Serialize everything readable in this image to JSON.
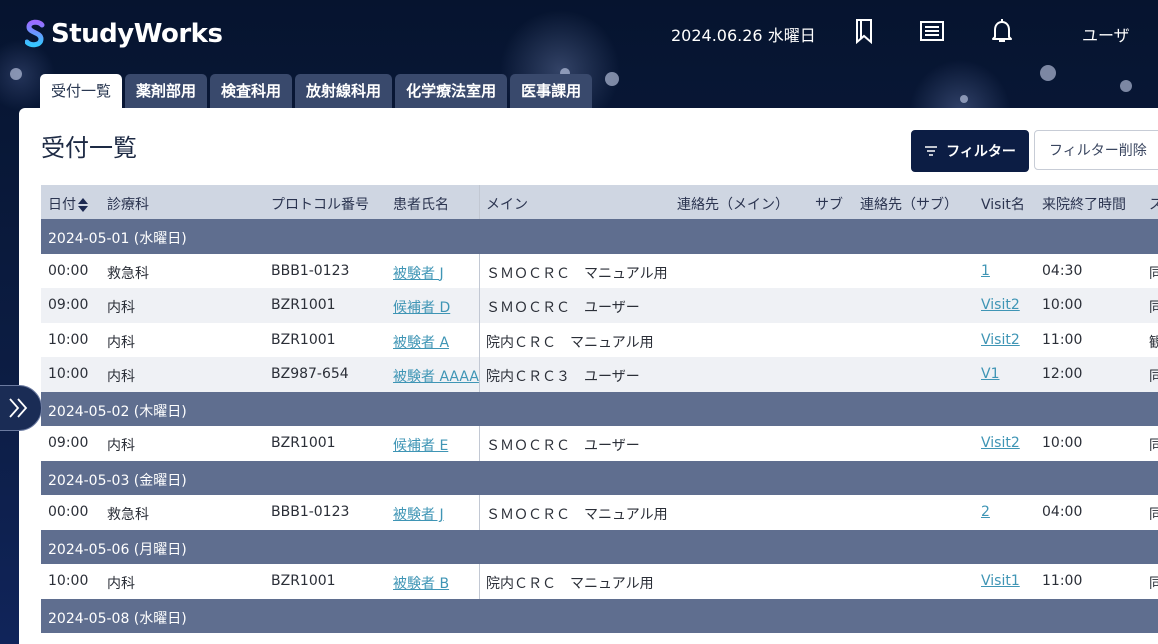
{
  "header": {
    "logo_letter": "S",
    "logo_text": "StudyWorks",
    "date": "2024.06.26 水曜日",
    "user": "ユーザ",
    "icons": [
      "bookmark-icon",
      "message-icon",
      "bell-icon"
    ]
  },
  "tabs": [
    {
      "label": "受付一覧",
      "active": true
    },
    {
      "label": "薬剤部用",
      "active": false
    },
    {
      "label": "検査科用",
      "active": false
    },
    {
      "label": "放射線科用",
      "active": false
    },
    {
      "label": "化学療法室用",
      "active": false
    },
    {
      "label": "医事課用",
      "active": false
    }
  ],
  "page_title": "受付一覧",
  "buttons": {
    "filter": "フィルター",
    "filter_clear": "フィルター削除"
  },
  "columns": [
    "日付",
    "診療科",
    "プロトコル番号",
    "患者氏名",
    "メイン",
    "連絡先（メイン）",
    "サブ",
    "連絡先（サブ）",
    "Visit名",
    "来院終了時間",
    "ス"
  ],
  "groups": [
    {
      "date": "2024-05-01 (水曜日)",
      "rows": [
        {
          "time": "00:00",
          "dept": "救急科",
          "protocol": "BBB1-0123",
          "patient": "被験者 J",
          "main": "ＳＭＯＣＲＣ　マニュアル用",
          "visit": "1",
          "end": "04:30",
          "status": "同"
        },
        {
          "time": "09:00",
          "dept": "内科",
          "protocol": "BZR1001",
          "patient": "候補者 D",
          "main": "ＳＭＯＣＲＣ　ユーザー",
          "visit": "Visit2",
          "end": "10:00",
          "status": "同"
        },
        {
          "time": "10:00",
          "dept": "内科",
          "protocol": "BZR1001",
          "patient": "被験者 A",
          "main": "院内ＣＲＣ　マニュアル用",
          "visit": "Visit2",
          "end": "11:00",
          "status": "観"
        },
        {
          "time": "10:00",
          "dept": "内科",
          "protocol": "BZ987-654",
          "patient": "被験者 AAAA",
          "main": "院内ＣＲＣ３　ユーザー",
          "visit": "V1",
          "end": "12:00",
          "status": "同"
        }
      ]
    },
    {
      "date": "2024-05-02 (木曜日)",
      "rows": [
        {
          "time": "09:00",
          "dept": "内科",
          "protocol": "BZR1001",
          "patient": "候補者 E",
          "main": "ＳＭＯＣＲＣ　ユーザー",
          "visit": "Visit2",
          "end": "10:00",
          "status": "同"
        }
      ]
    },
    {
      "date": "2024-05-03 (金曜日)",
      "rows": [
        {
          "time": "00:00",
          "dept": "救急科",
          "protocol": "BBB1-0123",
          "patient": "被験者 J",
          "main": "ＳＭＯＣＲＣ　マニュアル用",
          "visit": "2",
          "end": "04:00",
          "status": "同"
        }
      ]
    },
    {
      "date": "2024-05-06 (月曜日)",
      "rows": [
        {
          "time": "10:00",
          "dept": "内科",
          "protocol": "BZR1001",
          "patient": "被験者 B",
          "main": "院内ＣＲＣ　マニュアル用",
          "visit": "Visit1",
          "end": "11:00",
          "status": "同"
        }
      ]
    },
    {
      "date": "2024-05-08 (水曜日)",
      "rows": []
    }
  ],
  "colors": {
    "navy": "#0c1d44",
    "tab": "#39496c",
    "group": "#5f6e8f",
    "link": "#3f95b5"
  }
}
